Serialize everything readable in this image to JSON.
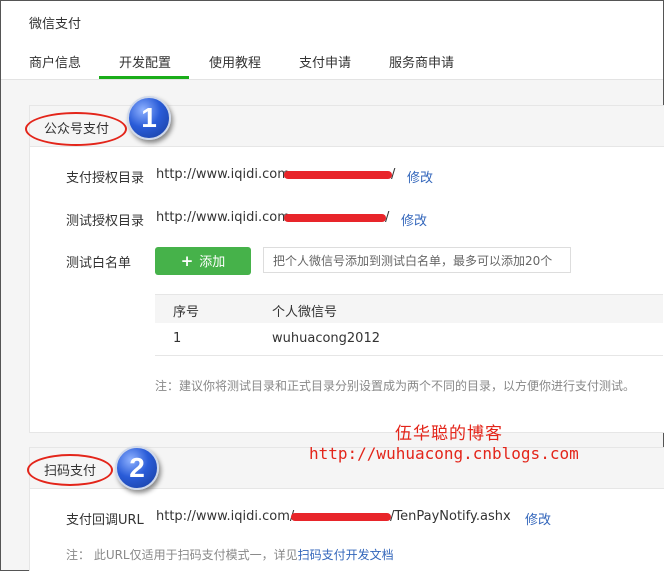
{
  "app": {
    "title": "微信支付"
  },
  "tabs": [
    {
      "label": "商户信息"
    },
    {
      "label": "开发配置"
    },
    {
      "label": "使用教程"
    },
    {
      "label": "支付申请"
    },
    {
      "label": "服务商申请"
    }
  ],
  "active_tab": "开发配置",
  "section1": {
    "title": "公众号支付",
    "badge": "1",
    "auth_dir": {
      "label": "支付授权目录",
      "url_prefix": "http://www.iqidi.com",
      "url_suffix": "/",
      "modify": "修改"
    },
    "test_dir": {
      "label": "测试授权目录",
      "url_prefix": "http://www.iqidi.com",
      "url_suffix": "/",
      "modify": "修改"
    },
    "whitelist": {
      "label": "测试白名单",
      "add_button": "添加",
      "input_placeholder": "把个人微信号添加到测试白名单，最多可以添加20个",
      "columns": [
        "序号",
        "个人微信号"
      ],
      "rows": [
        {
          "index": "1",
          "wechat_id": "wuhuacong2012"
        }
      ]
    },
    "note": "注：建议你将测试目录和正式目录分别设置成为两个不同的目录，以方便你进行支付测试。"
  },
  "section2": {
    "title": "扫码支付",
    "badge": "2",
    "callback": {
      "label": "支付回调URL",
      "url_prefix": "http://www.iqidi.com/",
      "url_suffix": "/TenPayNotify.ashx",
      "modify": "修改"
    },
    "note_prefix": "注： 此URL仅适用于扫码支付模式一，详见",
    "note_link": "扫码支付开发文档"
  },
  "watermark": {
    "title": "伍华聪的博客",
    "url": "http://wuhuacong.cnblogs.com"
  },
  "colors": {
    "accent": "#1aad19",
    "button": "#46b24a",
    "link": "#3366bb",
    "annotation": "#e3251a",
    "badge": "#2a5cd8"
  }
}
